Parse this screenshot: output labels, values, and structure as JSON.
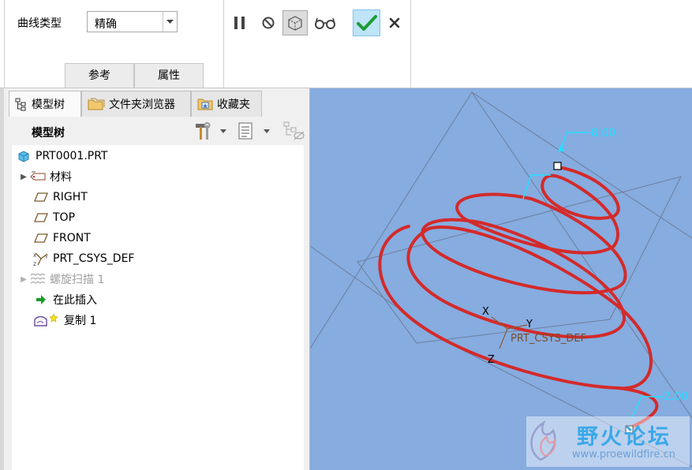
{
  "ribbon": {
    "curve_type_label": "曲线类型",
    "curve_type_value": "精确",
    "tab_reference": "参考",
    "tab_properties": "属性"
  },
  "panel": {
    "tabs": [
      "模型树",
      "文件夹浏览器",
      "收藏夹"
    ],
    "tree_title": "模型树"
  },
  "tree": {
    "root": "PRT0001.PRT",
    "items": [
      {
        "label": "材料"
      },
      {
        "label": "RIGHT"
      },
      {
        "label": "TOP"
      },
      {
        "label": "FRONT"
      },
      {
        "label": "PRT_CSYS_DEF"
      },
      {
        "label": "螺旋扫描 1"
      },
      {
        "label": "在此插入"
      },
      {
        "label": "复制 1"
      }
    ]
  },
  "viewport": {
    "dim_top": "8.00",
    "dim_bottom": "2.00",
    "csys_label": "PRT_CSYS_DEF",
    "axis_x": "X",
    "axis_y": "Y",
    "axis_z": "Z"
  },
  "watermark": {
    "title": "野火论坛",
    "url": "www.proewildfire.cn"
  },
  "colors": {
    "viewport_bg": "#86ace0",
    "helix": "#d42a2a",
    "dimension": "#22e0ff",
    "confirm_bg": "#bde4f7"
  }
}
